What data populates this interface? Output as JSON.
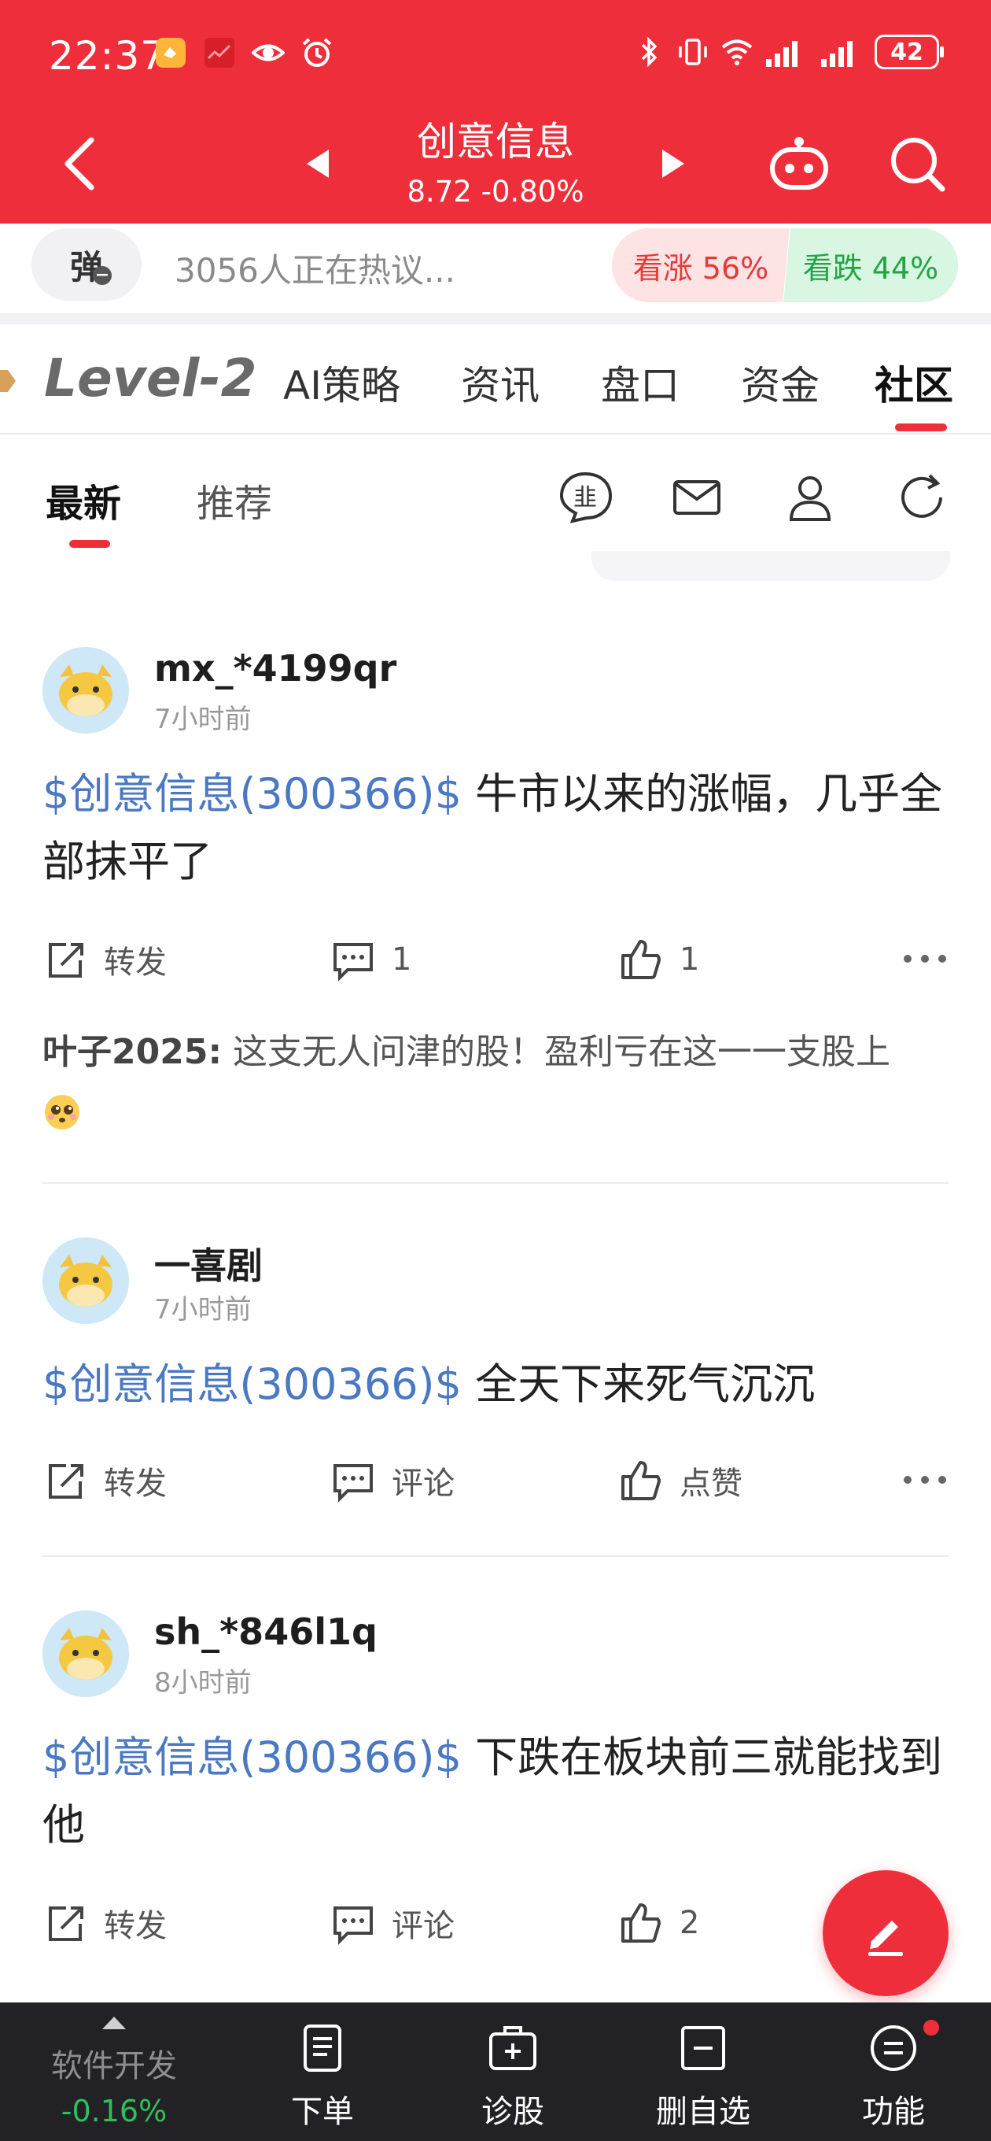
{
  "status_bar": {
    "time": "22:37",
    "battery": "42"
  },
  "header": {
    "stock_name": "创意信息",
    "quote": "8.72 -0.80%"
  },
  "sentiment": {
    "danmu_label": "弹",
    "discussing": "3056人正在热议...",
    "bull_label": "看涨 56%",
    "bear_label": "看跌 44%",
    "bull_percent": 56,
    "bear_percent": 44
  },
  "tabs": {
    "level2": "Level-2",
    "ai": "AI策略",
    "news": "资讯",
    "orderbook": "盘口",
    "funds": "资金",
    "community": "社区"
  },
  "subtabs": {
    "latest": "最新",
    "recommend": "推荐"
  },
  "posts": [
    {
      "username": "mx_*4199qr",
      "time": "7小时前",
      "stock_tag": "$创意信息(300366)$",
      "text": " 牛市以来的涨幅，几乎全部抹平了",
      "repost": "转发",
      "comments": "1",
      "likes": "1",
      "comment_author": "叶子2025:",
      "comment_text": " 这支无人问津的股！盈利亏在这一一支股上"
    },
    {
      "username": "一喜剧",
      "time": "7小时前",
      "stock_tag": "$创意信息(300366)$",
      "text": " 全天下来死气沉沉",
      "repost": "转发",
      "comments": "评论",
      "likes": "点赞"
    },
    {
      "username": "sh_*846l1q",
      "time": "8小时前",
      "stock_tag": "$创意信息(300366)$",
      "text": " 下跌在板块前三就能找到他",
      "repost": "转发",
      "comments": "评论",
      "likes": "2"
    }
  ],
  "bottom_bar": {
    "sector_name": "软件开发",
    "sector_change": "-0.16%",
    "order": "下单",
    "diagnose": "诊股",
    "remove_watch": "删自选",
    "functions": "功能"
  },
  "colors": {
    "brand_red": "#ee2f3b",
    "link_blue": "#4a78c2",
    "down_green": "#2fbf5a"
  }
}
